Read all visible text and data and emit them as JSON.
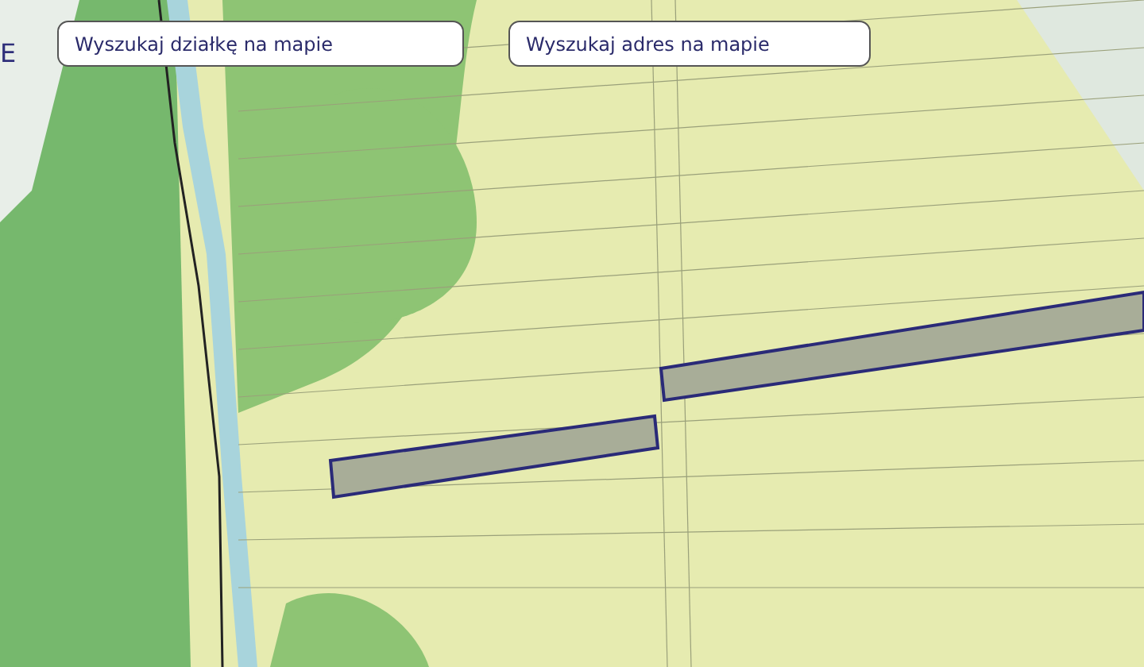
{
  "edge_label": "E",
  "search_buttons": [
    {
      "label": "Wyszukaj działkę na mapie"
    },
    {
      "label": "Wyszukaj adres na mapie"
    }
  ]
}
